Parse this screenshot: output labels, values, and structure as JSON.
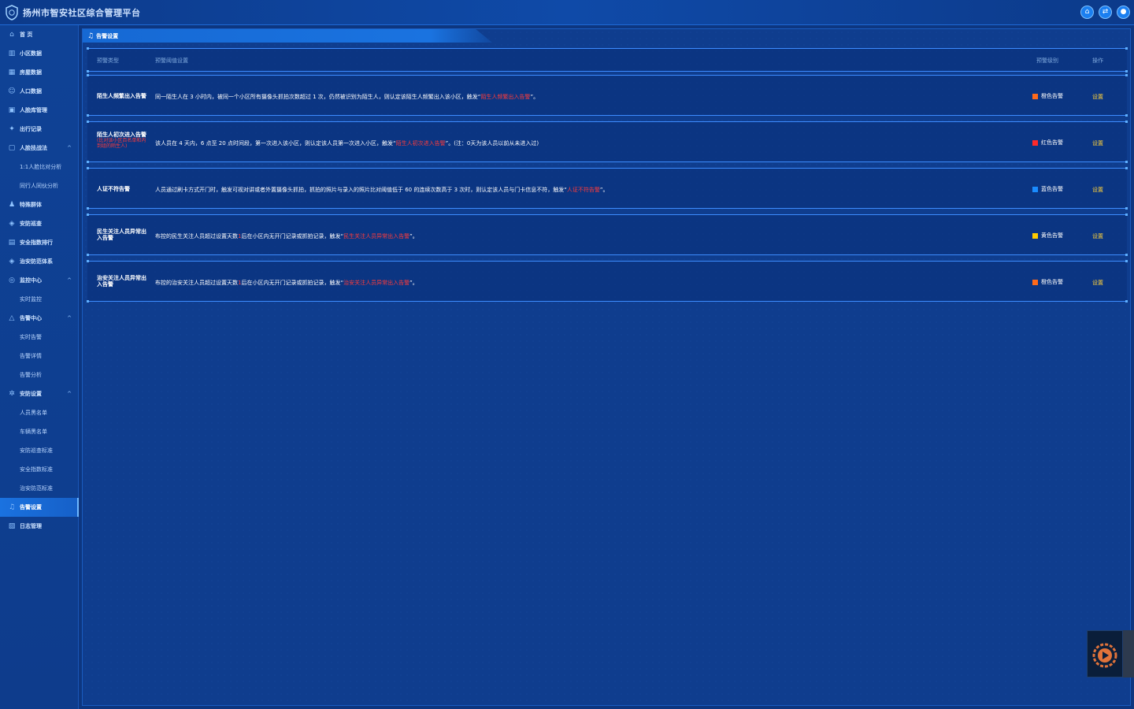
{
  "app": {
    "title": "扬州市智安社区综合管理平台"
  },
  "header": {
    "buttons": [
      {
        "icon": "home-icon",
        "glyph": "⌂"
      },
      {
        "icon": "switch-icon",
        "glyph": "⇄"
      },
      {
        "icon": "user-icon",
        "glyph": "●"
      }
    ]
  },
  "sidebar": {
    "items": [
      {
        "label": "首 页",
        "icon": "home-icon",
        "glyph": "⌂"
      },
      {
        "label": "小区数据",
        "icon": "bar-chart-icon",
        "glyph": "▥"
      },
      {
        "label": "房屋数据",
        "icon": "building-icon",
        "glyph": "▦"
      },
      {
        "label": "人口数据",
        "icon": "people-icon",
        "glyph": "☺"
      },
      {
        "label": "人脸库管理",
        "icon": "face-library-icon",
        "glyph": "▣"
      },
      {
        "label": "出行记录",
        "icon": "walk-icon",
        "glyph": "✦"
      },
      {
        "label": "人脸技战法",
        "icon": "face-scan-icon",
        "glyph": "▢",
        "expanded": true,
        "chevron": "^"
      },
      {
        "label": "1:1人脸比对分析",
        "sub": true
      },
      {
        "label": "同行人同伙分析",
        "sub": true
      },
      {
        "label": "特殊群体",
        "icon": "person-icon",
        "glyph": "♟"
      },
      {
        "label": "安防巡查",
        "icon": "shield-icon",
        "glyph": "◈"
      },
      {
        "label": "安全指数排行",
        "icon": "ranking-icon",
        "glyph": "▤"
      },
      {
        "label": "治安防范体系",
        "icon": "shield-check-icon",
        "glyph": "◈"
      },
      {
        "label": "监控中心",
        "icon": "camera-icon",
        "glyph": "◎",
        "expanded": true,
        "chevron": "^"
      },
      {
        "label": "实时监控",
        "sub": true
      },
      {
        "label": "告警中心",
        "icon": "warning-icon",
        "glyph": "△",
        "expanded": true,
        "chevron": "^"
      },
      {
        "label": "实时告警",
        "sub": true
      },
      {
        "label": "告警详情",
        "sub": true
      },
      {
        "label": "告警分析",
        "sub": true
      },
      {
        "label": "安防设置",
        "icon": "gear-icon",
        "glyph": "✲",
        "expanded": true,
        "chevron": "^"
      },
      {
        "label": "人员黑名单",
        "sub": true
      },
      {
        "label": "车辆黑名单",
        "sub": true
      },
      {
        "label": "安防巡查标准",
        "sub": true
      },
      {
        "label": "安全指数标准",
        "sub": true
      },
      {
        "label": "治安防范标准",
        "sub": true
      },
      {
        "label": "告警设置",
        "icon": "bell-icon",
        "glyph": "♫",
        "active": true
      },
      {
        "label": "日志管理",
        "icon": "log-icon",
        "glyph": "▧"
      }
    ]
  },
  "page": {
    "title": "告警设置",
    "title_icon": "bell-icon",
    "title_glyph": "♫"
  },
  "table": {
    "headers": {
      "type": "预警类型",
      "condition": "预警阈值设置",
      "level": "预警级别",
      "action": "操作"
    },
    "rows": [
      {
        "type": "陌生人频繁出入告警",
        "note": "",
        "desc_before": "同一陌生人在 3 小时内，被同一个小区所有摄像头抓拍次数超过 1 次，仍然被识别为陌生人，则认定该陌生人频繁出入该小区，触发“",
        "desc_highlight": "陌生人频繁出入告警",
        "desc_after": "”。",
        "level": "橙色告警",
        "level_color": "#ff6a1a",
        "action": "设置"
      },
      {
        "type": "陌生人初次进入告警",
        "note": "(比对该小区百名单和内到组的陌生人)",
        "desc_before": "该人员在 4 天内，6 点至 20 点时间段，第一次进入该小区，则认定该人员第一次进入小区，触发“",
        "desc_highlight": "陌生人初次进入告警",
        "desc_after": "”。(注：0天为该人员以前从未进入过)",
        "level": "红色告警",
        "level_color": "#ff2a2a",
        "action": "设置"
      },
      {
        "type": "人证不符告警",
        "note": "",
        "desc_before": "人员通过刷卡方式开门时，触发可视对讲或者外置摄像头抓拍，抓拍的照片与录入的照片比对阈值低于 60 的连续次数高于 3 次时，则认定该人员与门卡信息不符，触发“",
        "desc_highlight": "人证不符告警",
        "desc_after": "”。",
        "level": "蓝色告警",
        "level_color": "#1a8cff",
        "action": "设置"
      },
      {
        "type": "民生关注人员异常出入告警",
        "note": "",
        "desc_before": "布控的民生关注人员超过设置天数",
        "desc_mid_red": "1",
        "desc_mid": "后在小区内无开门记录或抓拍记录，触发“",
        "desc_highlight": "民生关注人员异常出入告警",
        "desc_after": "”。",
        "level": "黄色告警",
        "level_color": "#ffcc00",
        "action": "设置"
      },
      {
        "type": "治安关注人员异常出入告警",
        "note": "",
        "desc_before": "布控的治安关注人员超过设置天数",
        "desc_mid_red": "1",
        "desc_mid": "后在小区内无开门记录或抓拍记录，触发“",
        "desc_highlight": "治安关注人员异常出入告警",
        "desc_after": "”。",
        "level": "橙色告警",
        "level_color": "#ff6a1a",
        "action": "设置"
      }
    ]
  },
  "float_widget": {
    "icon": "video-assistant-icon"
  }
}
